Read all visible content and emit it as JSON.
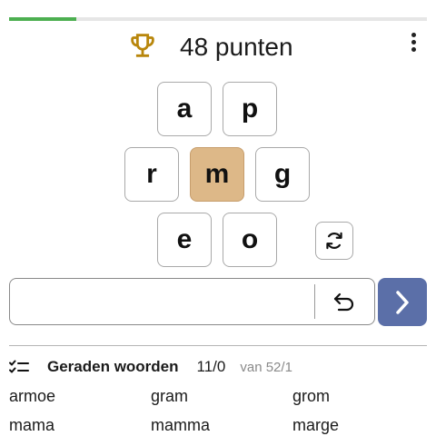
{
  "progress": {
    "fraction": 0.16,
    "color": "#4caf50"
  },
  "header": {
    "score_text": "48 punten",
    "trophy_color": "#b8860b",
    "menu_icon": "more-vert-icon"
  },
  "tiles": {
    "top_left": "a",
    "top_right": "p",
    "mid_left": "r",
    "center": "m",
    "mid_right": "g",
    "bottom_left": "e",
    "bottom_right": "o"
  },
  "controls": {
    "shuffle_icon": "shuffle-icon",
    "input_value": "",
    "undo_icon": "undo-icon",
    "submit_icon": "chevron-right-icon",
    "submit_color": "#5b6fa8",
    "center_tile_color": "#ddb888"
  },
  "found": {
    "title": "Geraden woorden",
    "count": "11/0",
    "total": "van 52/1",
    "words": [
      "armoe",
      "gram",
      "grom",
      "mama",
      "mamma",
      "marge"
    ]
  }
}
